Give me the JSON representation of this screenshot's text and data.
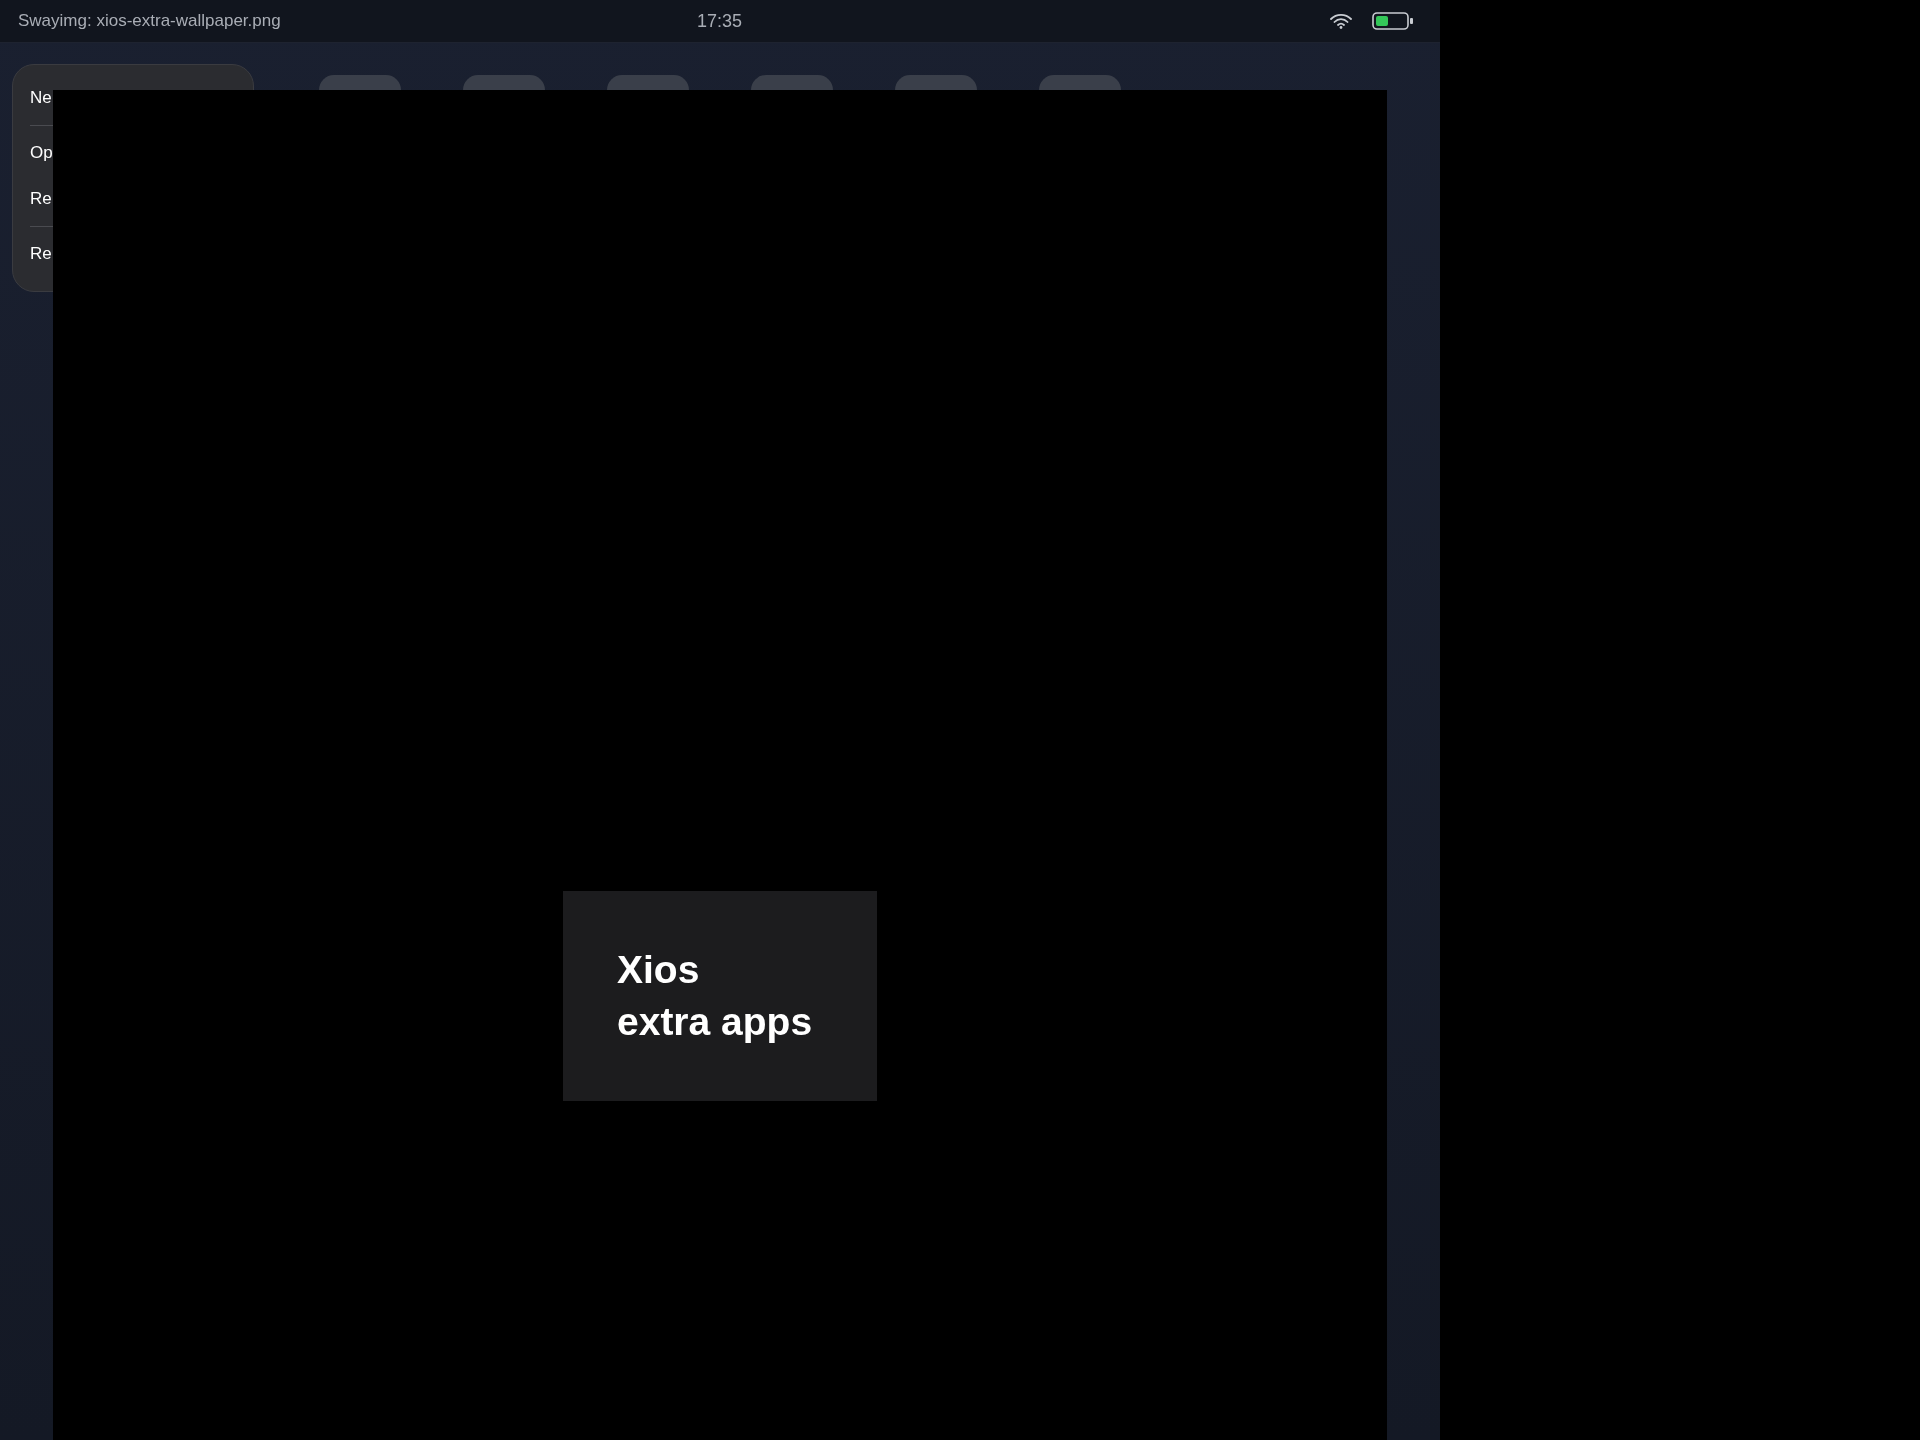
{
  "status_bar": {
    "title": "Swayimg: xios-extra-wallpaper.png",
    "time": "17:35"
  },
  "context_menu": {
    "groups": [
      [
        "Ne"
      ],
      [
        "Op",
        "Re"
      ],
      [
        "Re"
      ]
    ]
  },
  "app_tiles": [
    {
      "kind": "tile"
    },
    {
      "kind": "tile"
    },
    {
      "kind": "tile"
    },
    {
      "kind": "tile"
    },
    {
      "kind": "tile"
    },
    {
      "kind": "tile"
    }
  ],
  "image_viewer": {
    "image_text": [
      "Xios",
      "extra apps"
    ]
  }
}
